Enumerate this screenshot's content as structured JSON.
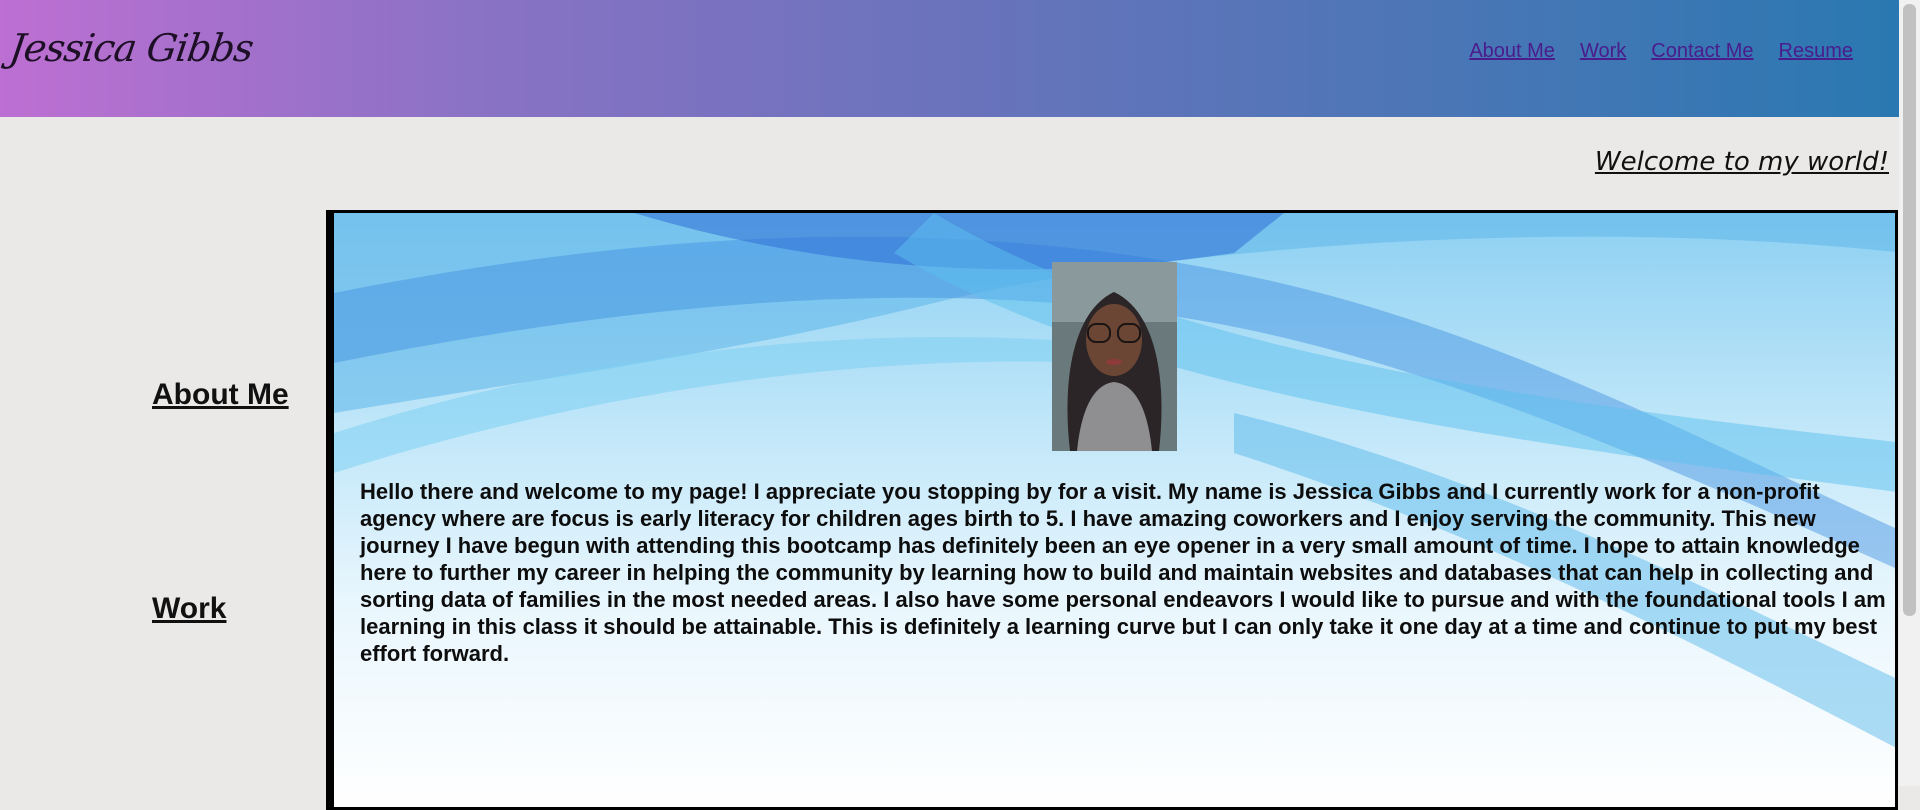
{
  "header": {
    "brand": "Jessica Gibbs",
    "nav": [
      "About Me",
      "Work",
      "Contact Me",
      "Resume"
    ]
  },
  "welcome": "Welcome to my world!",
  "sidebar": {
    "about_label": "About Me",
    "work_label": "Work"
  },
  "main": {
    "bio": "Hello there and welcome to my page! I appreciate you stopping by for a visit. My name is Jessica Gibbs and I currently work for a non-profit agency where are focus is early literacy for children ages birth to 5. I have amazing coworkers and I enjoy serving the community. This new journey I have begun with attending this bootcamp has definitely been an eye opener in a very small amount of time. I hope to attain knowledge here to further my career in helping the community by learning how to build and maintain websites and databases that can help in collecting and sorting data of families in the most needed areas. I also have some personal endeavors I would like to pursue and with the foundational tools I am learning in this class it should be attainable. This is definitely a learning curve but I can only take it one day at a time and continue to put my best effort forward."
  },
  "colors": {
    "header_gradient_start": "#bd6fd2",
    "header_gradient_end": "#2a78b1",
    "nav_link": "#4a1c8c",
    "page_bg": "#ebe9e7"
  }
}
